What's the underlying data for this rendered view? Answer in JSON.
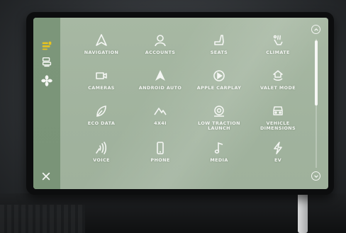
{
  "sidebar": {
    "items": [
      {
        "icon": "car-seat-heat-icon",
        "active": true
      },
      {
        "icon": "seat-settings-icon",
        "active": false
      },
      {
        "icon": "fan-icon",
        "active": false
      }
    ],
    "close_icon": "close-icon"
  },
  "apps": [
    {
      "name": "NAVIGATION",
      "icon": "navigation-arrow-icon"
    },
    {
      "name": "ACCOUNTS",
      "icon": "user-account-icon"
    },
    {
      "name": "SEATS",
      "icon": "seat-icon"
    },
    {
      "name": "CLIMATE",
      "icon": "climate-icon"
    },
    {
      "name": "CAMERAS",
      "icon": "camera-icon"
    },
    {
      "name": "ANDROID AUTO",
      "icon": "android-auto-icon"
    },
    {
      "name": "APPLE CARPLAY",
      "icon": "carplay-icon"
    },
    {
      "name": "VALET MODE",
      "icon": "valet-mode-icon"
    },
    {
      "name": "ECO DATA",
      "icon": "leaf-icon"
    },
    {
      "name": "4X4I",
      "icon": "mountain-icon"
    },
    {
      "name": "LOW TRACTION\nLAUNCH",
      "icon": "traction-icon"
    },
    {
      "name": "VEHICLE\nDIMENSIONS",
      "icon": "vehicle-dimensions-icon"
    },
    {
      "name": "VOICE",
      "icon": "voice-icon"
    },
    {
      "name": "PHONE",
      "icon": "phone-icon"
    },
    {
      "name": "MEDIA",
      "icon": "music-note-icon"
    },
    {
      "name": "EV",
      "icon": "lightning-icon"
    }
  ],
  "scroll": {
    "up_icon": "chevron-up-icon",
    "down_icon": "chevron-down-icon"
  },
  "colors": {
    "screen": "#a3b5a0",
    "sidebar": "#7b9579",
    "text": "#f4f6f3",
    "accent_icon": "#e8c31e"
  }
}
